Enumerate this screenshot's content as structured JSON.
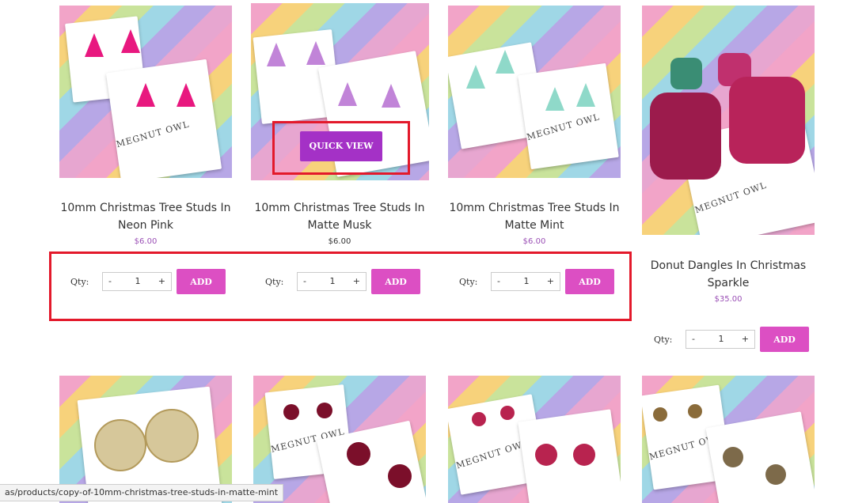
{
  "products_row1": [
    {
      "title_line1": "10mm Christmas Tree Studs In",
      "title_line2": "Neon Pink",
      "price": "$6.00",
      "tree_color": "#e8187f"
    },
    {
      "title_line1": "10mm Christmas Tree Studs In",
      "title_line2": "Matte Musk",
      "price": "$6.00",
      "tree_color": "#c184d8"
    },
    {
      "title_line1": "10mm Christmas Tree Studs In",
      "title_line2": "Matte Mint",
      "price": "$6.00",
      "tree_color": "#8fd9c9"
    },
    {
      "title_line1": "Donut Dangles In Christmas",
      "title_line2": "Sparkle",
      "price": "$35.00"
    }
  ],
  "qty_label": "Qty:",
  "stepper": {
    "minus": "-",
    "plus": "+",
    "value": "1"
  },
  "add_label": "ADD",
  "quick_view_label": "QUICK VIEW",
  "brand_text": "MEGNUT OWL",
  "status_bar_url": "as/products/copy-of-10mm-christmas-tree-studs-in-matte-mint",
  "colors": {
    "accent_add": "#dc4fc3",
    "quick_view": "#a431c6",
    "highlight": "#e3192b",
    "price": "#9a4fb5"
  }
}
